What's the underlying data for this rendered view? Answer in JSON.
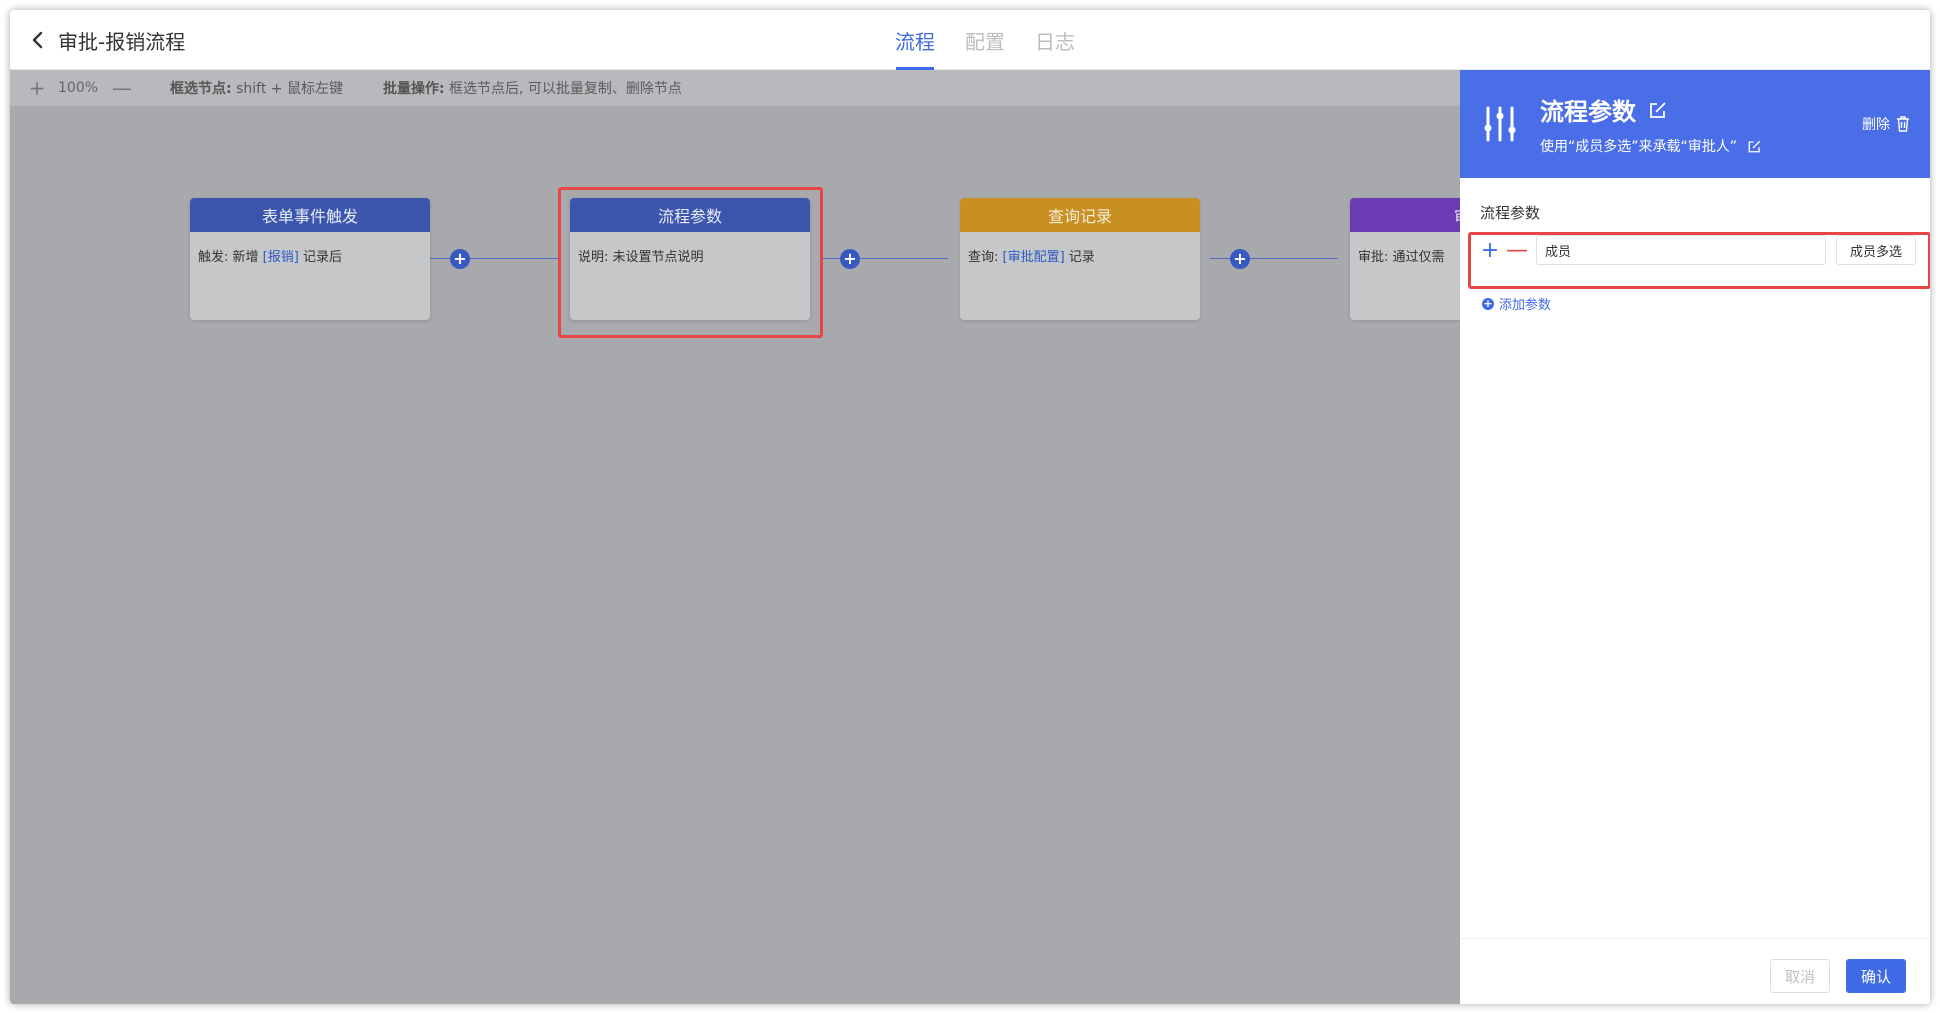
{
  "header": {
    "title": "审批-报销流程",
    "tabs": [
      {
        "label": "流程"
      },
      {
        "label": "配置"
      },
      {
        "label": "日志"
      }
    ]
  },
  "toolbar": {
    "zoom_in": "+",
    "zoom_level": "100%",
    "zoom_out": "—",
    "hint1_label": "框选节点:",
    "hint1_text": "shift + 鼠标左键",
    "hint2_label": "批量操作:",
    "hint2_text": "框选节点后, 可以批量复制、删除节点"
  },
  "nodes": [
    {
      "title": "表单事件触发",
      "prefix": "触发: 新增 ",
      "link": "[报销]",
      "suffix": " 记录后"
    },
    {
      "title": "流程参数",
      "prefix": "说明: 未设置节点说明",
      "link": "",
      "suffix": ""
    },
    {
      "title": "查询记录",
      "prefix": "查询: ",
      "link": "[审批配置]",
      "suffix": " 记录"
    },
    {
      "title": "审批",
      "prefix": "审批: 通过仅需",
      "link": "",
      "suffix": ""
    }
  ],
  "panel": {
    "title": "流程参数",
    "subtitle": "使用“成员多选”来承载“审批人”",
    "delete_label": "删除",
    "section_label": "流程参数",
    "param": {
      "name": "成员",
      "type": "成员多选"
    },
    "add_param_label": "添加参数",
    "cancel_label": "取消",
    "confirm_label": "确认"
  },
  "colors": {
    "accent": "#3e6ae6",
    "panel_header": "#4a6ee8",
    "highlight": "#e84545",
    "node_blue": "#3c56ad",
    "node_orange": "#c89020",
    "node_purple": "#6a3bb2"
  }
}
